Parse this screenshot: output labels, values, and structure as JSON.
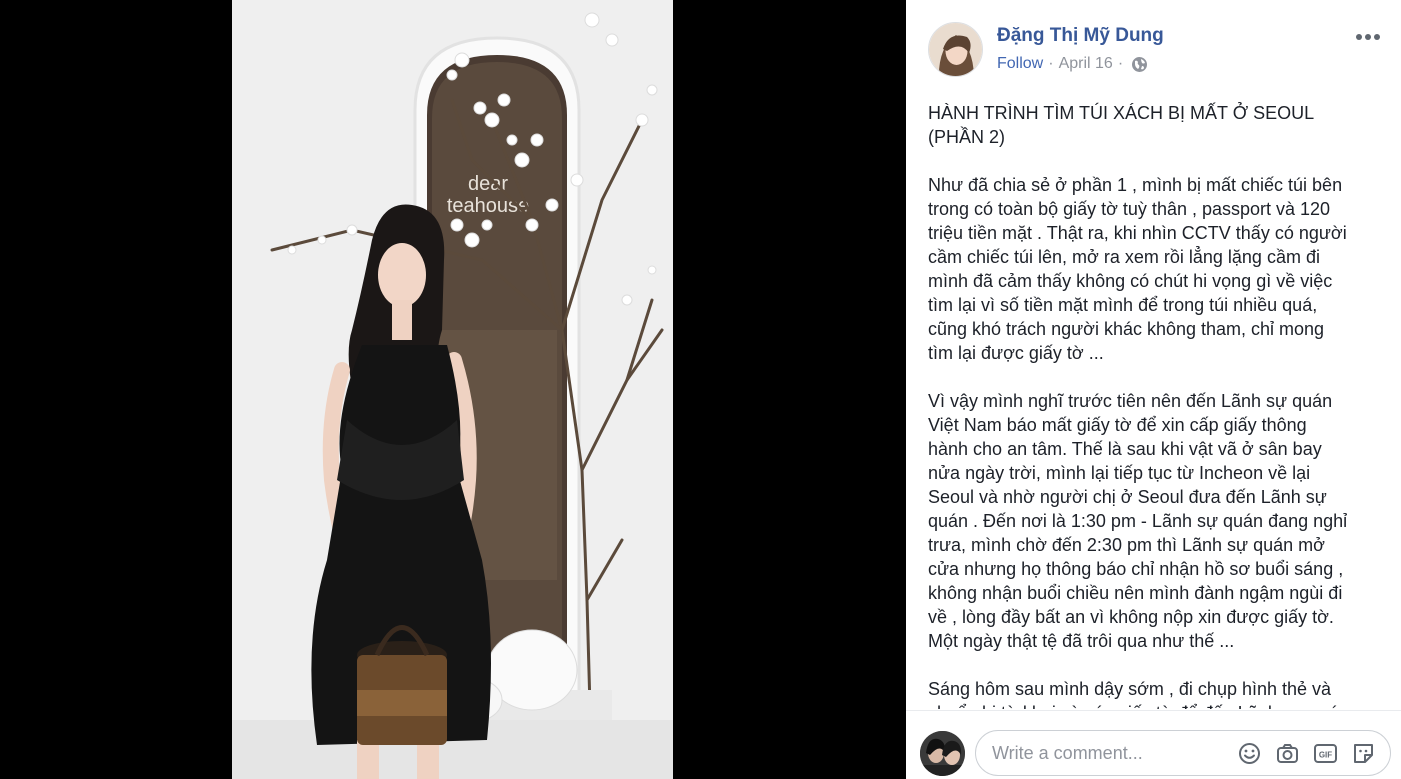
{
  "photo": {
    "sign_line1": "dear",
    "sign_line2": "teahouse"
  },
  "post": {
    "author": "Đặng Thị Mỹ Dung",
    "follow_label": "Follow",
    "date": "April 16",
    "dot": "·",
    "privacy_icon": "globe-icon",
    "more_icon": "more-options-icon",
    "title": "HÀNH TRÌNH TÌM TÚI XÁCH BỊ MẤT Ở SEOUL\n(PHẦN 2)",
    "paragraphs": [
      "Như đã chia sẻ ở phần 1 , mình bị mất chiếc túi bên\ntrong có toàn bộ giấy tờ tuỳ thân , passport và 120\ntriệu tiền mặt . Thật ra, khi nhìn CCTV thấy có người\ncầm chiếc túi lên, mở ra xem rồi lẳng lặng cầm đi\nmình đã cảm thấy không có chút hi vọng gì về việc\ntìm lại vì số tiền mặt mình để trong túi nhiều quá,\ncũng khó trách người khác không tham, chỉ mong\ntìm lại được giấy tờ ...",
      "Vì vậy mình nghĩ trước tiên nên đến Lãnh sự quán\nViệt Nam báo mất giấy tờ để xin cấp giấy thông\nhành cho an tâm. Thế là sau khi vật vã ở sân bay\nnửa ngày trời, mình lại tiếp tục từ Incheon về lại\nSeoul và nhờ người chị ở Seoul đưa đến Lãnh sự\nquán . Đến nơi là 1:30 pm - Lãnh sự quán đang nghỉ\ntrưa, mình chờ đến 2:30 pm thì Lãnh sự quán mở\ncửa nhưng họ thông báo chỉ nhận hồ sơ buổi sáng ,\nkhông nhận buổi chiều nên mình đành ngậm ngùi đi\nvề , lòng đầy bất an vì không nộp xin được giấy tờ.\nMột ngày thật tệ đã trôi qua như thế ...",
      "Sáng hôm sau mình dậy sớm , đi chụp hình thẻ và\nchuẩn bị tờ khai và các giấy tờ để đến Lãnh sự quán"
    ]
  },
  "comment": {
    "placeholder": "Write a comment...",
    "icons": [
      "emoji-icon",
      "camera-icon",
      "gif-icon",
      "sticker-icon"
    ],
    "gif_label": "GIF"
  },
  "colors": {
    "author": "#385898",
    "follow": "#4267b2",
    "meta": "#90949c",
    "text": "#1d2129"
  }
}
